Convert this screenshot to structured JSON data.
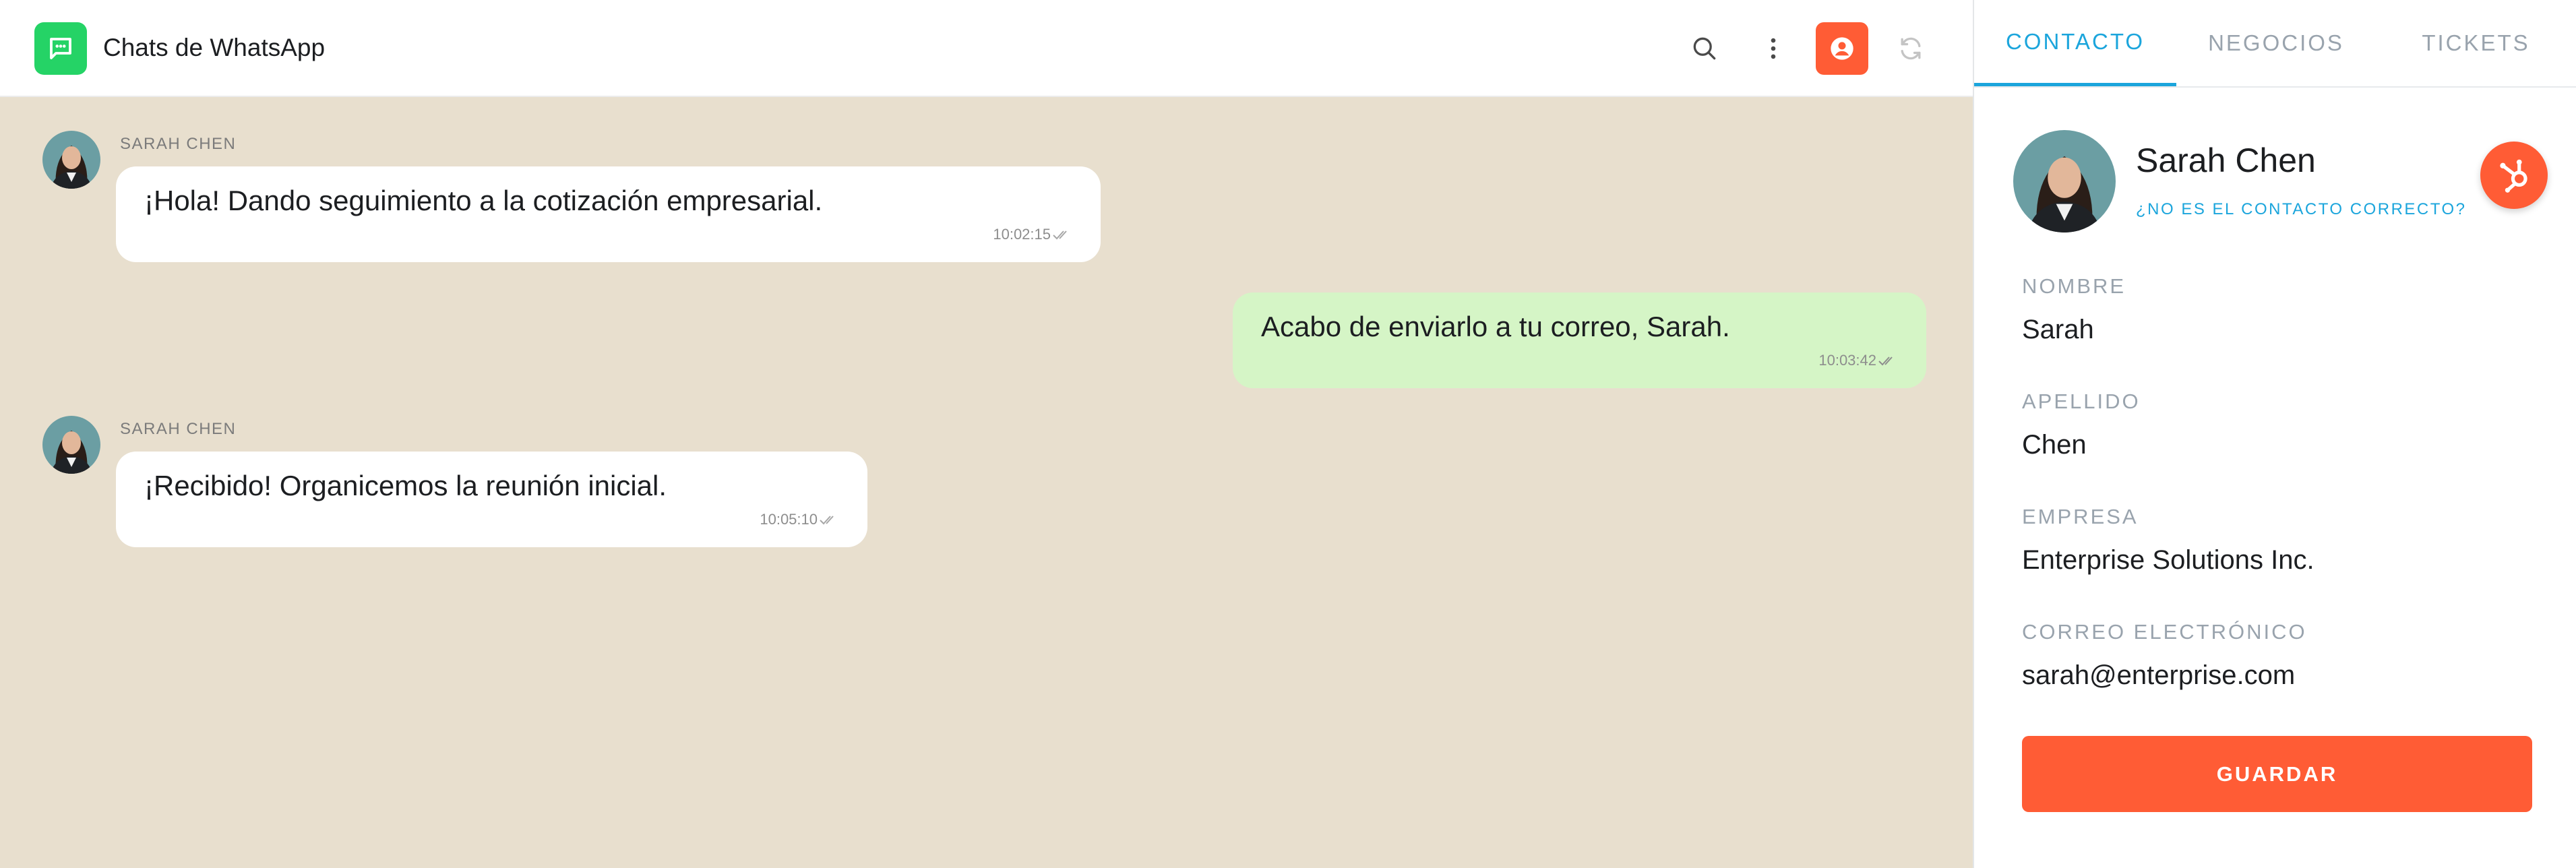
{
  "header": {
    "title": "Chats de WhatsApp",
    "icons": [
      "chat-icon",
      "search-icon",
      "more-vertical-icon",
      "user-circle-icon",
      "refresh-icon"
    ]
  },
  "messages": [
    {
      "direction": "incoming",
      "sender": "SARAH CHEN",
      "text": "¡Hola! Dando seguimiento a la cotización empresarial.",
      "time": "10:02:15"
    },
    {
      "direction": "outgoing",
      "sender": "",
      "text": "Acabo de enviarlo a tu correo, Sarah.",
      "time": "10:03:42"
    },
    {
      "direction": "incoming",
      "sender": "SARAH CHEN",
      "text": "¡Recibido! Organicemos la reunión inicial.",
      "time": "10:05:10"
    }
  ],
  "panel": {
    "tabs": [
      {
        "label": "CONTACTO",
        "active": true
      },
      {
        "label": "NEGOCIOS",
        "active": false
      },
      {
        "label": "TICKETS",
        "active": false
      }
    ],
    "contact": {
      "name": "Sarah Chen",
      "wrong_contact_link": "¿NO ES EL CONTACTO CORRECTO?"
    },
    "fields": [
      {
        "label": "NOMBRE",
        "value": "Sarah"
      },
      {
        "label": "APELLIDO",
        "value": "Chen"
      },
      {
        "label": "EMPRESA",
        "value": "Enterprise Solutions Inc."
      },
      {
        "label": "CORREO ELECTRÓNICO",
        "value": "sarah@enterprise.com"
      }
    ],
    "save_label": "GUARDAR"
  },
  "colors": {
    "whatsapp_green": "#25d366",
    "hubspot_orange": "#ff5c35",
    "tab_active": "#1ba5dc",
    "chat_background": "#e8dfce",
    "outgoing_bubble": "#d5f5c6"
  }
}
